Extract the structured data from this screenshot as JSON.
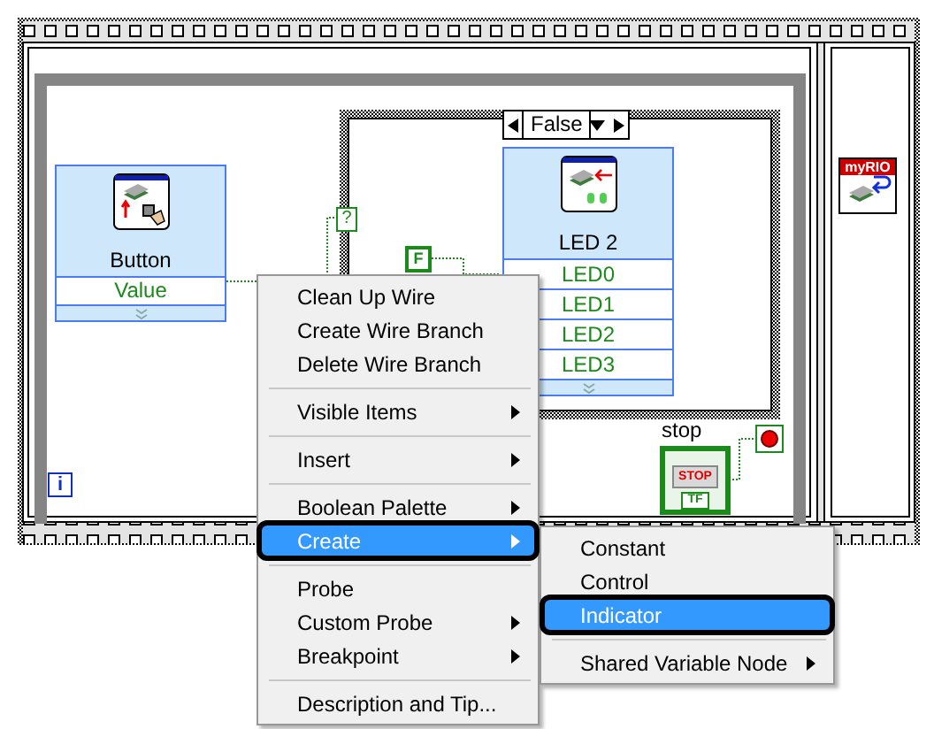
{
  "diagram": {
    "case_selector": "False",
    "selector_terminal": "?",
    "false_constant": "F",
    "iteration_terminal": "i",
    "button_node": {
      "label": "Button",
      "terminal": "Value"
    },
    "led_node": {
      "label": "LED 2",
      "terminals": [
        "LED0",
        "LED1",
        "LED2",
        "LED3"
      ]
    },
    "myrio_node": {
      "label": "myRIO"
    },
    "stop_terminal": {
      "label": "stop",
      "button_text": "STOP",
      "type_text": "TF"
    }
  },
  "context_menu": {
    "items": [
      {
        "kind": "item",
        "label": "Clean Up Wire",
        "submenu": false,
        "selected": false
      },
      {
        "kind": "item",
        "label": "Create Wire Branch",
        "submenu": false,
        "selected": false
      },
      {
        "kind": "item",
        "label": "Delete Wire Branch",
        "submenu": false,
        "selected": false
      },
      {
        "kind": "separator"
      },
      {
        "kind": "item",
        "label": "Visible Items",
        "submenu": true,
        "selected": false
      },
      {
        "kind": "separator"
      },
      {
        "kind": "item",
        "label": "Insert",
        "submenu": true,
        "selected": false
      },
      {
        "kind": "separator"
      },
      {
        "kind": "item",
        "label": "Boolean Palette",
        "submenu": true,
        "selected": false
      },
      {
        "kind": "item",
        "label": "Create",
        "submenu": true,
        "selected": true
      },
      {
        "kind": "separator"
      },
      {
        "kind": "item",
        "label": "Probe",
        "submenu": false,
        "selected": false
      },
      {
        "kind": "item",
        "label": "Custom Probe",
        "submenu": true,
        "selected": false
      },
      {
        "kind": "item",
        "label": "Breakpoint",
        "submenu": true,
        "selected": false
      },
      {
        "kind": "separator"
      },
      {
        "kind": "item",
        "label": "Description and Tip...",
        "submenu": false,
        "selected": false
      }
    ]
  },
  "submenu": {
    "items": [
      {
        "kind": "item",
        "label": "Constant",
        "submenu": false,
        "selected": false
      },
      {
        "kind": "item",
        "label": "Control",
        "submenu": false,
        "selected": false
      },
      {
        "kind": "item",
        "label": "Indicator",
        "submenu": false,
        "selected": true
      },
      {
        "kind": "separator"
      },
      {
        "kind": "item",
        "label": "Shared Variable Node",
        "submenu": true,
        "selected": false
      }
    ]
  }
}
